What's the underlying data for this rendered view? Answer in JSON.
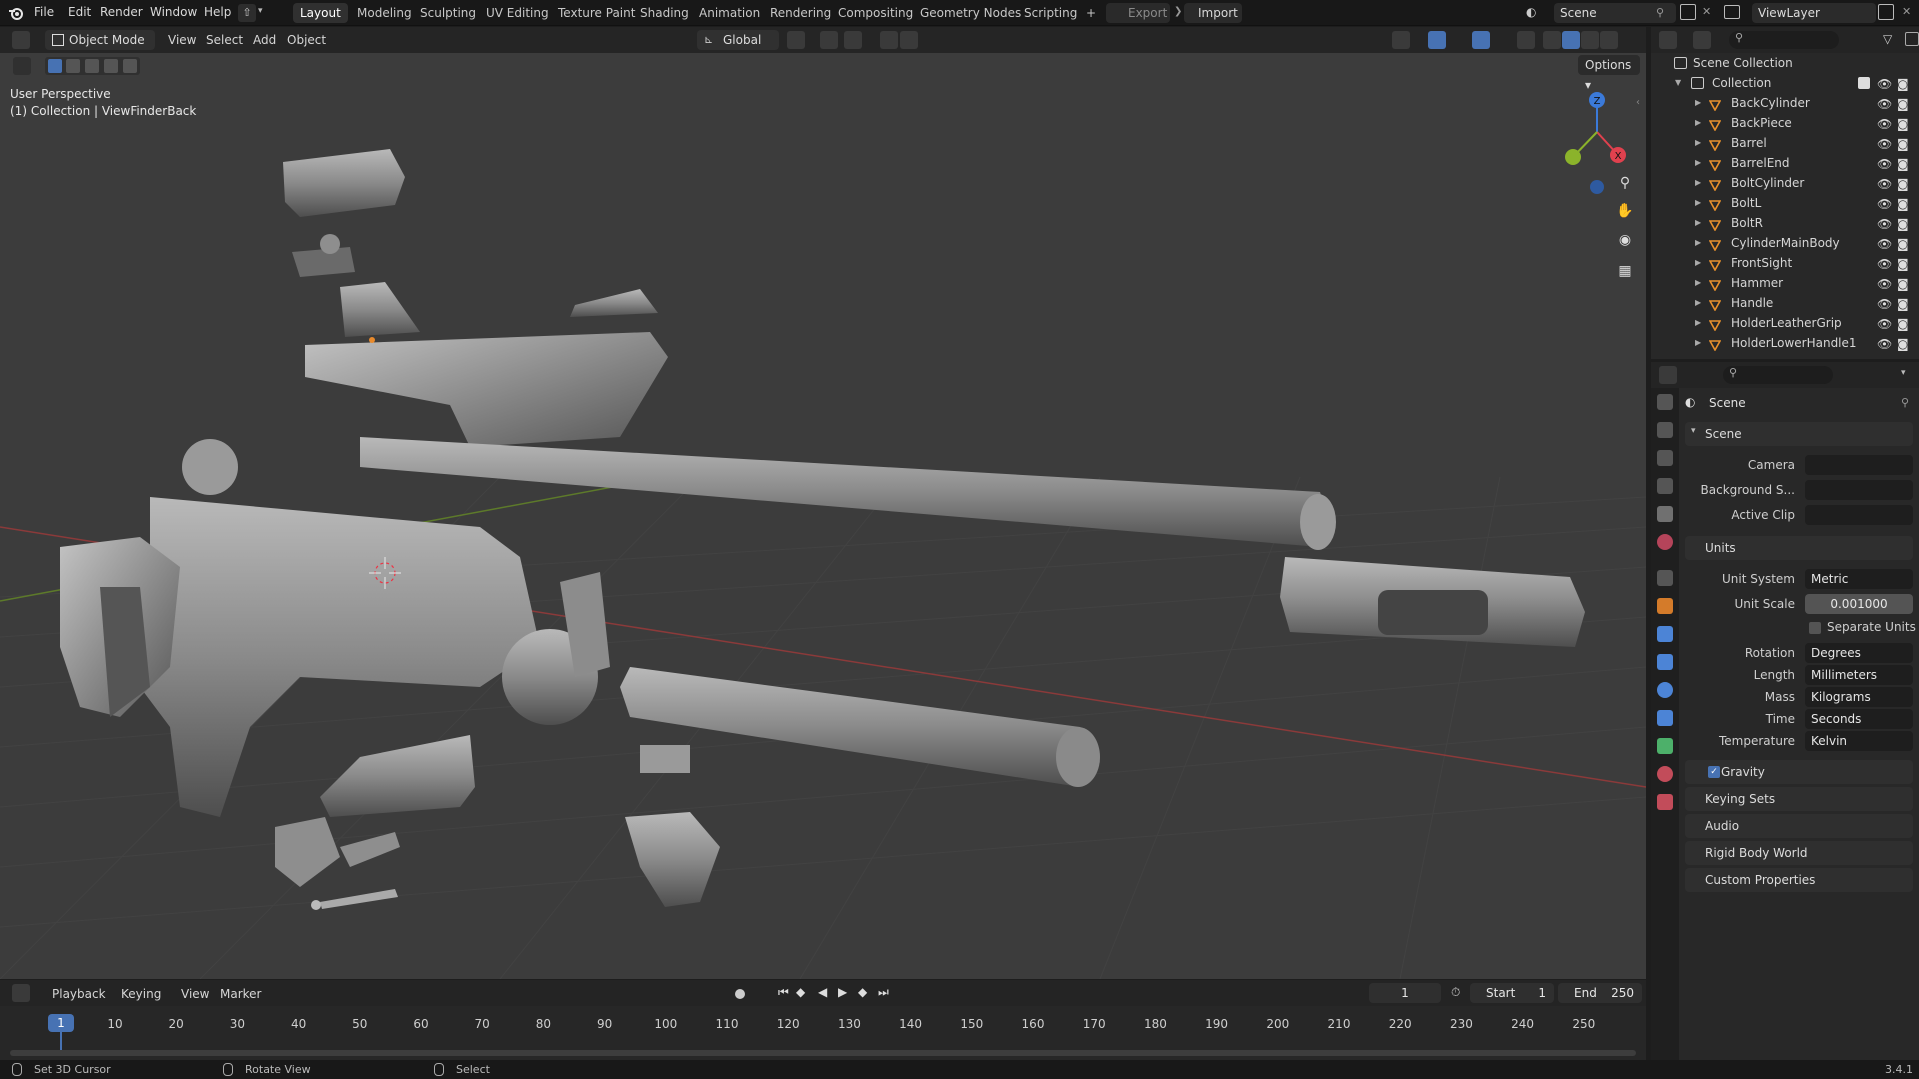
{
  "topbar": {
    "menus": [
      "File",
      "Edit",
      "Render",
      "Window",
      "Help"
    ],
    "workspaces": [
      "Layout",
      "Modeling",
      "Sculpting",
      "UV Editing",
      "Texture Paint",
      "Shading",
      "Animation",
      "Rendering",
      "Compositing",
      "Geometry Nodes",
      "Scripting"
    ],
    "active_workspace": "Layout",
    "add_tab": "+",
    "export_label": "Export",
    "import_label": "Import",
    "scene_name": "Scene",
    "view_layer": "ViewLayer"
  },
  "viewport": {
    "mode": "Object Mode",
    "menus": [
      "View",
      "Select",
      "Add",
      "Object"
    ],
    "orientation": "Global",
    "options_label": "Options",
    "perspective_label": "User Perspective",
    "context_label": "(1) Collection | ViewFinderBack",
    "gizmo": {
      "x": "X",
      "y": "Y",
      "z": "Z"
    },
    "x_color": "#e0414e",
    "y_color": "#8bb32b",
    "z_color": "#3b7ad9"
  },
  "outliner": {
    "root": "Scene Collection",
    "collection": "Collection",
    "items": [
      {
        "name": "BackCylinder"
      },
      {
        "name": "BackPiece"
      },
      {
        "name": "Barrel"
      },
      {
        "name": "BarrelEnd"
      },
      {
        "name": "BoltCylinder"
      },
      {
        "name": "BoltL"
      },
      {
        "name": "BoltR"
      },
      {
        "name": "CylinderMainBody"
      },
      {
        "name": "FrontSight"
      },
      {
        "name": "Hammer"
      },
      {
        "name": "Handle"
      },
      {
        "name": "HolderLeatherGrip"
      },
      {
        "name": "HolderLowerHandle1"
      }
    ]
  },
  "properties": {
    "context_title": "Scene",
    "scene_panel": "Scene",
    "camera_label": "Camera",
    "background_label": "Background S...",
    "active_clip_label": "Active Clip",
    "units_panel": "Units",
    "unit_system_label": "Unit System",
    "unit_system_value": "Metric",
    "unit_scale_label": "Unit Scale",
    "unit_scale_value": "0.001000",
    "separate_units_label": "Separate Units",
    "rotation_label": "Rotation",
    "rotation_value": "Degrees",
    "length_label": "Length",
    "length_value": "Millimeters",
    "mass_label": "Mass",
    "mass_value": "Kilograms",
    "time_label": "Time",
    "time_value": "Seconds",
    "temperature_label": "Temperature",
    "temperature_value": "Kelvin",
    "collapsed_panels": [
      "Gravity",
      "Keying Sets",
      "Audio",
      "Rigid Body World",
      "Custom Properties"
    ]
  },
  "timeline": {
    "menus": [
      "Playback",
      "Keying",
      "View",
      "Marker"
    ],
    "current_frame": "1",
    "start_label": "Start",
    "start_value": "1",
    "end_label": "End",
    "end_value": "250",
    "ticks": [
      "10",
      "20",
      "30",
      "40",
      "50",
      "60",
      "70",
      "80",
      "90",
      "100",
      "110",
      "120",
      "130",
      "140",
      "150",
      "160",
      "170",
      "180",
      "190",
      "200",
      "210",
      "220",
      "230",
      "240",
      "250"
    ],
    "playhead": "1"
  },
  "status": {
    "hint1": "Set 3D Cursor",
    "hint2": "Rotate View",
    "hint3": "Select",
    "version": "3.4.1"
  }
}
